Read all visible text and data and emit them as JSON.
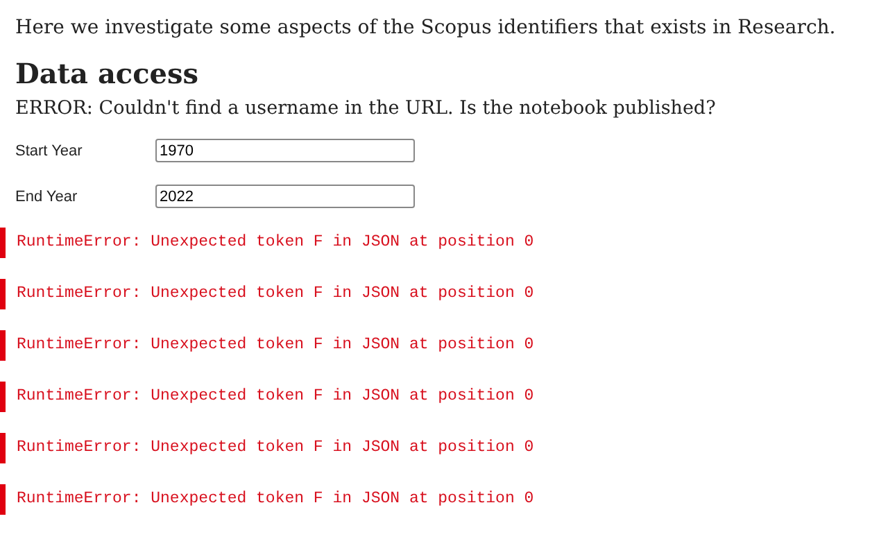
{
  "intro": "Here we investigate some aspects of the Scopus identifiers that exists in Research.",
  "heading": "Data access",
  "message": "ERROR: Couldn't find a username in the URL. Is the notebook published?",
  "fields": [
    {
      "label": "Start Year",
      "value": "1970"
    },
    {
      "label": "End Year",
      "value": "2022"
    }
  ],
  "errors": [
    "RuntimeError: Unexpected token F in JSON at position 0",
    "RuntimeError: Unexpected token F in JSON at position 0",
    "RuntimeError: Unexpected token F in JSON at position 0",
    "RuntimeError: Unexpected token F in JSON at position 0",
    "RuntimeError: Unexpected token F in JSON at position 0",
    "RuntimeError: Unexpected token F in JSON at position 0"
  ]
}
